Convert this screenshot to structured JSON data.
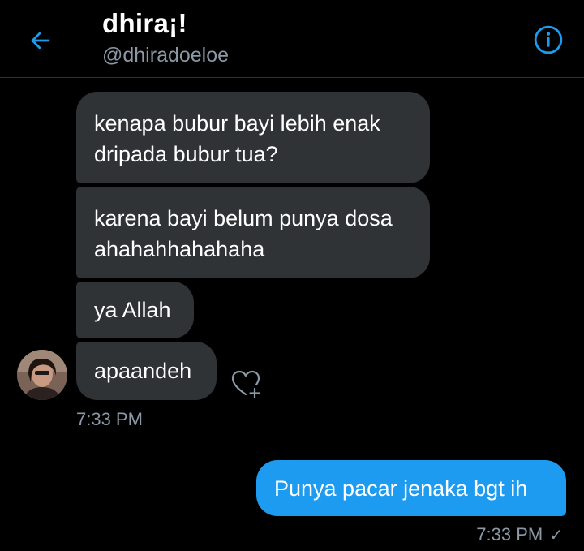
{
  "header": {
    "display_name": "dhira¡!",
    "handle": "@dhiradoeloe",
    "back_icon": "arrow-left-icon",
    "info_icon": "info-circle-icon",
    "accent_color": "#1d9bf0"
  },
  "messages": {
    "incoming": [
      {
        "text": "kenapa bubur bayi lebih enak dripada bubur tua?"
      },
      {
        "text": "karena bayi belum punya dosa ahahahhahahaha"
      },
      {
        "text": "ya Allah"
      },
      {
        "text": "apaandeh"
      }
    ],
    "incoming_time": "7:33 PM",
    "outgoing": [
      {
        "text": "Punya pacar jenaka bgt ih"
      }
    ],
    "outgoing_time": "7:33 PM",
    "outgoing_status_icon": "checkmark-icon",
    "reaction_icon": "heart-plus-icon"
  },
  "colors": {
    "background": "#000000",
    "incoming_bubble": "#2f3336",
    "outgoing_bubble": "#1d9bf0",
    "muted_text": "#8b98a5"
  }
}
